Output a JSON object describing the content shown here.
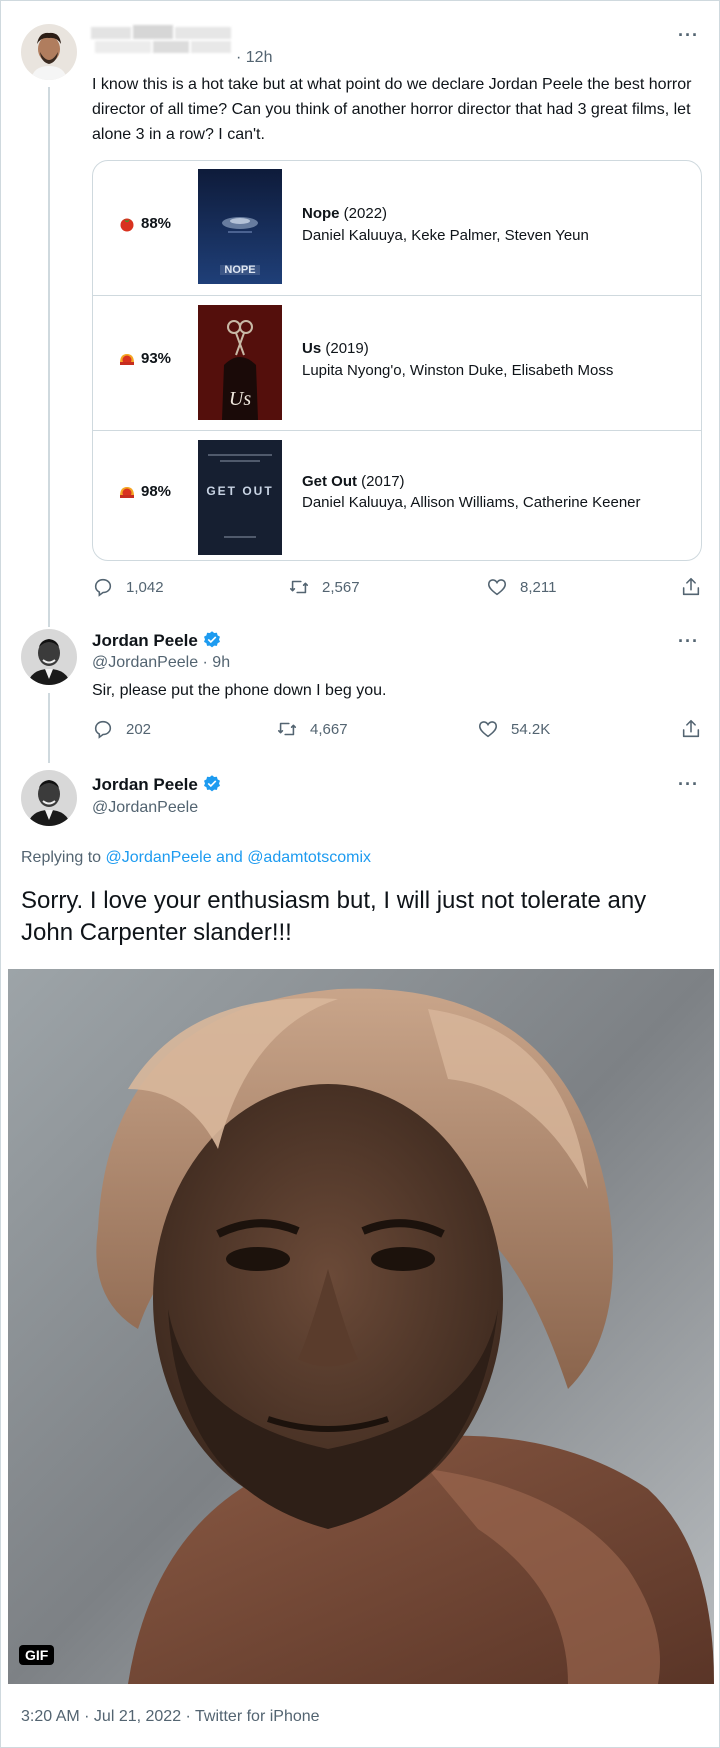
{
  "tweet1": {
    "time": "· 12h",
    "text": "I know this is a hot take but at what point do we declare Jordan Peele the best horror director of all time? Can you think of another horror director that had 3 great films, let alone 3 in a row? I can't.",
    "films": [
      {
        "score": "88%",
        "title": "Nope",
        "year": "(2022)",
        "cast": "Daniel Kaluuya, Keke Palmer, Steven Yeun",
        "poster_text": "NOPE",
        "score_icon": "fresh-tomato-icon"
      },
      {
        "score": "93%",
        "title": "Us",
        "year": "(2019)",
        "cast": "Lupita Nyong'o, Winston Duke, Elisabeth Moss",
        "poster_text": "Us",
        "score_icon": "certified-fresh-icon"
      },
      {
        "score": "98%",
        "title": "Get Out",
        "year": "(2017)",
        "cast": "Daniel Kaluuya, Allison Williams, Catherine Keener",
        "poster_text": "GET OUT",
        "score_icon": "certified-fresh-icon"
      }
    ],
    "replies": "1,042",
    "retweets": "2,567",
    "likes": "8,211"
  },
  "tweet2": {
    "name": "Jordan Peele",
    "handle": "@JordanPeele · 9h",
    "text": "Sir, please put the phone down I beg you.",
    "replies": "202",
    "retweets": "4,667",
    "likes": "54.2K"
  },
  "tweet3": {
    "name": "Jordan Peele",
    "handle": "@JordanPeele",
    "replying_prefix": "Replying to ",
    "replying_user1": "@JordanPeele",
    "replying_and": " and ",
    "replying_user2": "@adamtotscomix",
    "text": "Sorry. I love your enthusiasm but, I will just not tolerate any John Carpenter slander!!!",
    "media_badge": "GIF",
    "footer": "3:20 AM · Jul 21, 2022 · Twitter for iPhone"
  },
  "colors": {
    "accent": "#1d9bf0",
    "secondary_text": "#536471",
    "border": "#cfd9de",
    "tomato_red": "#d9321f"
  }
}
